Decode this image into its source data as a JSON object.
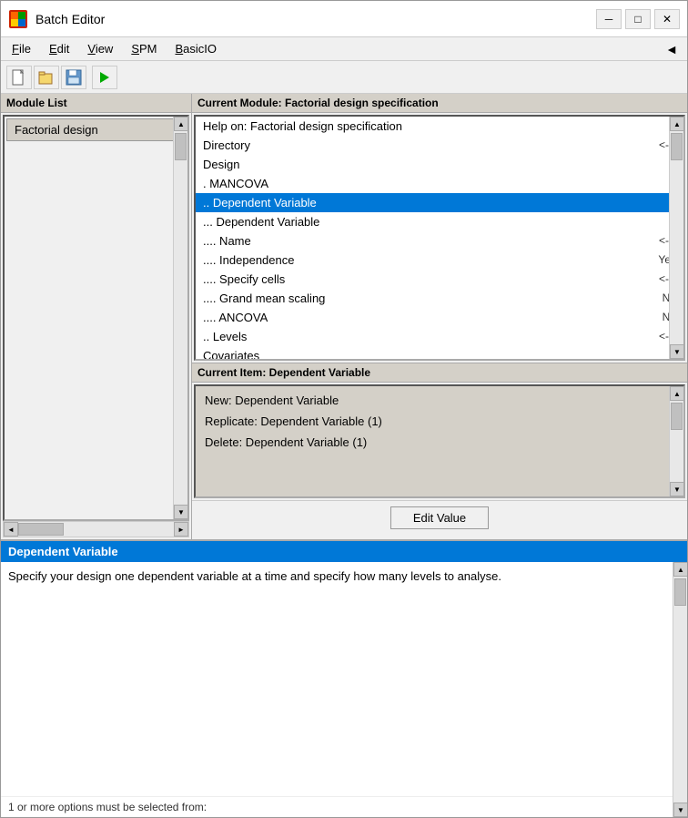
{
  "window": {
    "title": "Batch Editor",
    "controls": {
      "minimize": "─",
      "maximize": "□",
      "close": "✕"
    }
  },
  "menu": {
    "items": [
      {
        "label": "File",
        "underline_index": 0
      },
      {
        "label": "Edit",
        "underline_index": 0
      },
      {
        "label": "View",
        "underline_index": 0
      },
      {
        "label": "SPM",
        "underline_index": 0
      },
      {
        "label": "BasicIO",
        "underline_index": 0
      }
    ]
  },
  "toolbar": {
    "new_label": "📄",
    "open_label": "📂",
    "save_label": "💾",
    "run_label": "▶"
  },
  "module_list": {
    "header": "Module List",
    "items": [
      {
        "label": "Factorial design"
      }
    ]
  },
  "current_module": {
    "header": "Current Module: Factorial design specification",
    "tree_items": [
      {
        "label": "Help on: Factorial design specification",
        "value": "",
        "selected": false,
        "indent": 0
      },
      {
        "label": "Directory",
        "value": "<-X",
        "selected": false,
        "indent": 0
      },
      {
        "label": "Design",
        "value": "",
        "selected": false,
        "indent": 0
      },
      {
        "label": ". MANCOVA",
        "value": "",
        "selected": false,
        "indent": 1
      },
      {
        "label": ".. Dependent Variable",
        "value": "",
        "selected": true,
        "indent": 2
      },
      {
        "label": "... Dependent Variable",
        "value": "",
        "selected": false,
        "indent": 3
      },
      {
        "label": ".... Name",
        "value": "<-X",
        "selected": false,
        "indent": 4
      },
      {
        "label": ".... Independence",
        "value": "Yes",
        "selected": false,
        "indent": 4
      },
      {
        "label": ".... Specify cells",
        "value": "<-X",
        "selected": false,
        "indent": 4
      },
      {
        "label": ".... Grand mean scaling",
        "value": "No",
        "selected": false,
        "indent": 4
      },
      {
        "label": ".... ANCOVA",
        "value": "No",
        "selected": false,
        "indent": 4
      },
      {
        "label": ".. Levels",
        "value": "<-X",
        "selected": false,
        "indent": 2
      },
      {
        "label": "Covariates",
        "value": "",
        "selected": false,
        "indent": 0
      }
    ]
  },
  "current_item": {
    "header": "Current Item: Dependent Variable",
    "actions": [
      {
        "label": "New: Dependent Variable"
      },
      {
        "label": "Replicate: Dependent Variable (1)"
      },
      {
        "label": "Delete: Dependent Variable (1)"
      }
    ]
  },
  "buttons": {
    "edit_value": "Edit Value"
  },
  "description": {
    "header": "Dependent Variable",
    "text": "Specify  your design one dependent variable at a time and specify how many levels to analyse.",
    "footer": "1 or more options must be selected from:"
  }
}
